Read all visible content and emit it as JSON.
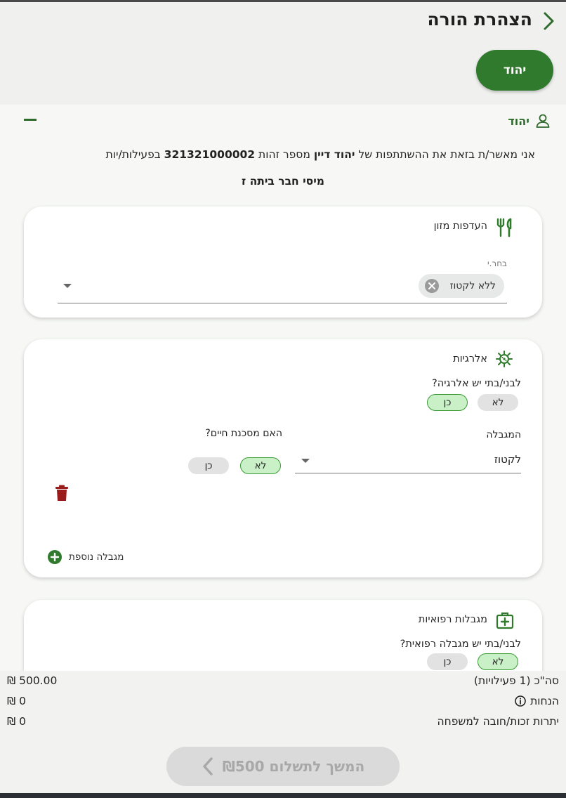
{
  "header": {
    "title": "הצהרת הורה",
    "child_chip": "יהוד"
  },
  "child_section": {
    "child_name": "יהוד",
    "declaration": {
      "prefix": "אני מאשר/ת בזאת את ההשתתפות של",
      "participant_name": "יהוד דיין",
      "id_label": "מספר זהות",
      "id_number": "321321000002",
      "suffix": "בפעילות/יות",
      "activity": "מיסי חבר ביתה ז"
    }
  },
  "food_card": {
    "title": "העדפות מזון",
    "select_label": "בחר.י",
    "selected_chip": "ללא לקטוז"
  },
  "allergy_card": {
    "title": "אלרגיות",
    "question": "לבני/בתי יש אלרגיה?",
    "no_label": "לא",
    "yes_label": "כן",
    "selected": "yes",
    "restriction_label": "המגבלה",
    "restriction_value": "לקטוז",
    "life_threat_question": "האם מסכנת חיים?",
    "life_no_label": "לא",
    "life_yes_label": "כן",
    "life_selected": "no",
    "add_restriction_label": "מגבלה נוספת"
  },
  "medical_card": {
    "title": "מגבלות רפואיות",
    "question": "לבני/בתי יש מגבלה רפואית?",
    "no_label": "לא",
    "yes_label": "כן",
    "selected": "no"
  },
  "totals": {
    "total_label": "סה\"כ (1 פעילויות)",
    "total_value": "500.00 ₪",
    "discounts_label": "הנחות",
    "discounts_value": "0 ₪",
    "balance_label": "יתרות זכות/חובה למשפחה",
    "balance_value": "0 ₪"
  },
  "pay_button": {
    "label": "המשך לתשלום ₪500"
  },
  "colors": {
    "brand_green": "#2f7a2c",
    "selected_pill_bg": "#c9f0c6",
    "trash_red": "#9b1c1c"
  }
}
